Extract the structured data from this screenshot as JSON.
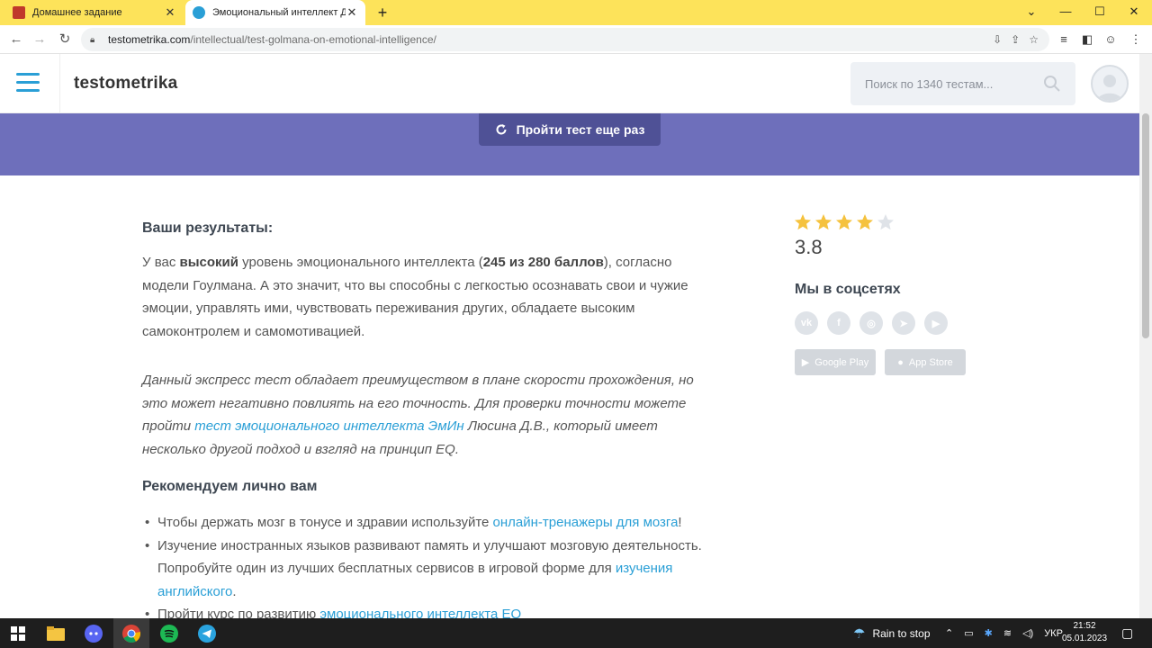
{
  "browser": {
    "tabs": [
      {
        "title": "Домашнее задание",
        "active": false
      },
      {
        "title": "Эмоциональный интеллект Дэн",
        "active": true
      }
    ],
    "url_host": "testometrika.com",
    "url_path": "/intellectual/test-golmana-on-emotional-intelligence/"
  },
  "site": {
    "logo": "testometrika",
    "search_placeholder": "Поиск по 1340 тестам...",
    "retry_button": "Пройти тест еще раз"
  },
  "content": {
    "results_heading": "Ваши результаты:",
    "result_p1": "У вас ",
    "result_level": "высокий",
    "result_p2": " уровень эмоционального интеллекта (",
    "result_score": "245 из 280 баллов",
    "result_p3": "), согласно модели Гоулмана. А это значит, что вы способны с легкостью осознавать свои и чужие эмоции, управлять ими, чувствовать переживания других, обладаете высоким самоконтролем и самомотивацией.",
    "note_p1": "Данный экспресс тест обладает преимуществом в плане скорости прохождения, но это может негативно повлиять на его точность. Для проверки точности можете пройти ",
    "note_link": "тест эмоционального интеллекта ЭмИн",
    "note_p2": " Люсина Д.В., который имеет несколько другой подход и взгляд на принцип EQ.",
    "rec_heading": "Рекомендуем лично вам",
    "rec1_text": "Чтобы держать мозг в тонусе и здравии используйте ",
    "rec1_link": "онлайн-тренажеры для мозга",
    "rec1_end": "!",
    "rec2_text": "Изучение иностранных языков развивают память и улучшают мозговую деятельность. Попробуйте один из лучших бесплатных сервисов в игровой форме для ",
    "rec2_link": "изучения английского",
    "rec2_end": ".",
    "rec3_text": "Пройти курс по развитию ",
    "rec3_link": "эмоционального интеллекта EQ"
  },
  "sidebar": {
    "rating": "3.8",
    "rating_stars_filled": 4,
    "rating_stars_total": 5,
    "social_heading": "Мы в соцсетях",
    "social_icons": [
      "vk-icon",
      "facebook-icon",
      "instagram-icon",
      "telegram-icon",
      "youtube-icon"
    ],
    "google_play": "Google Play",
    "app_store": "App Store"
  },
  "taskbar": {
    "weather": "Rain to stop",
    "language": "УКР",
    "time": "21:52",
    "date": "05.01.2023"
  },
  "colors": {
    "accent": "#2a9fd6",
    "band": "#6e6fbb",
    "button": "#4f5196",
    "star": "#f5c23e",
    "tabbar": "#fde35a"
  }
}
